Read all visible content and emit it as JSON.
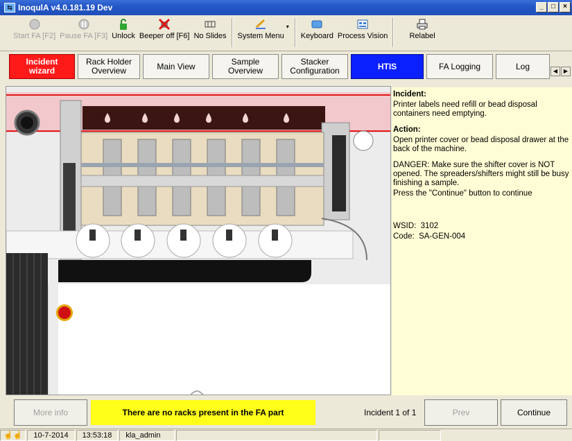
{
  "window": {
    "title": "InoqulA v4.0.181.19 Dev",
    "buttons": [
      "_",
      "□",
      "×"
    ]
  },
  "toolbar": {
    "items": [
      {
        "label": "Start FA [F2]",
        "icon": "start-icon",
        "enabled": false
      },
      {
        "label": "Pause FA [F3]",
        "icon": "pause-icon",
        "enabled": false
      },
      {
        "label": "Unlock",
        "icon": "lock-icon",
        "enabled": true
      },
      {
        "label": "Beeper off [F6]",
        "icon": "beeper-icon",
        "enabled": true
      },
      {
        "label": "No Slides",
        "icon": "slides-icon",
        "enabled": true
      },
      {
        "label": "System Menu",
        "icon": "system-menu-icon",
        "enabled": true
      },
      {
        "label": "Keyboard",
        "icon": "keyboard-icon",
        "enabled": true
      },
      {
        "label": "Process Vision",
        "icon": "process-vision-icon",
        "enabled": true
      },
      {
        "label": "Relabel",
        "icon": "printer-icon",
        "enabled": true
      }
    ]
  },
  "tabs": [
    {
      "label": "Incident wizard"
    },
    {
      "label": "Rack Holder Overview"
    },
    {
      "label": "Main View"
    },
    {
      "label": "Sample Overview"
    },
    {
      "label": "Stacker Configuration"
    },
    {
      "label": "HTIS"
    },
    {
      "label": "FA Logging"
    },
    {
      "label": "Log"
    }
  ],
  "incident": {
    "incident_title": "Incident:",
    "incident_text": "Printer labels need refill or bead disposal containers need emptying.",
    "action_title": "Action:",
    "action_text": "Open printer cover or bead disposal drawer at the back of the machine.",
    "danger_text": "DANGER: Make sure the shifter cover is NOT opened. The spreaders/shifters might still be busy finishing a sample.",
    "continue_hint": "Press the \"Continue\" button to continue",
    "wsid_label": "WSID:",
    "wsid_value": "3102",
    "code_label": "Code:",
    "code_value": "SA-GEN-004"
  },
  "bottom": {
    "more_info": "More info",
    "message": "There are no racks present in the FA part",
    "count": "Incident 1 of 1",
    "prev": "Prev",
    "continue": "Continue"
  },
  "status": {
    "date": "10-7-2014",
    "time": "13:53:18",
    "user": "kla_admin"
  },
  "colors": {
    "incident_tab": "#ff1a1a",
    "htis_tab": "#0b20ff",
    "message_bg": "#ffff1a",
    "panel_bg": "#fffdd5"
  }
}
